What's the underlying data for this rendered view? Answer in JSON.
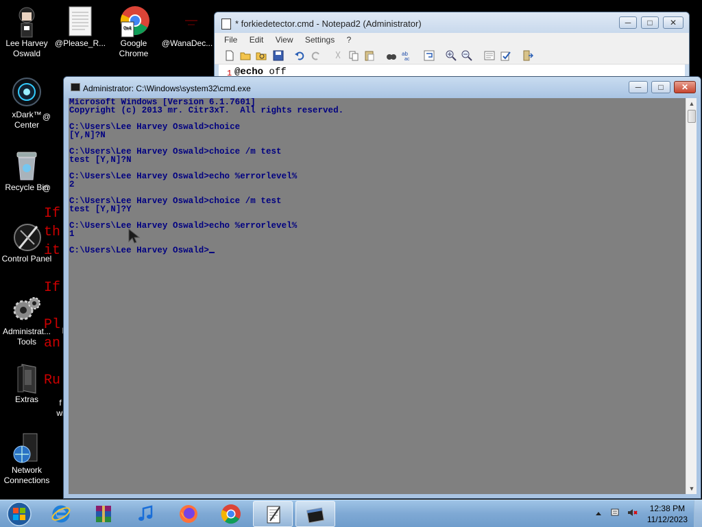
{
  "desktop": {
    "icons": [
      {
        "label": "Lee Harvey Oswald"
      },
      {
        "label": "@Please_R..."
      },
      {
        "label": "Google Chrome"
      },
      {
        "label": "@WanaDec..."
      },
      {
        "label": "xDark™ Center"
      },
      {
        "label": "Recycle Bin"
      },
      {
        "label": "Control Panel"
      },
      {
        "label": "Administrat... Tools"
      },
      {
        "label": "Extras"
      },
      {
        "label": "Network Connections"
      }
    ],
    "partial_labels": [
      "@",
      "@",
      "f",
      "wi",
      "I"
    ],
    "red_text": [
      "If",
      "th",
      "it",
      "If",
      "Pl",
      "an",
      "Ru"
    ]
  },
  "notepad": {
    "title": "* forkiedetector.cmd - Notepad2 (Administrator)",
    "menu": [
      "File",
      "Edit",
      "View",
      "Settings",
      "?"
    ],
    "line_number": "1",
    "code_keyword": "@echo",
    "code_rest": " off"
  },
  "cmd": {
    "title": "Administrator: C:\\Windows\\system32\\cmd.exe",
    "lines": [
      "Microsoft Windows [Version 6.1.7601]",
      "Copyright (c) 2013 mr. Citr3xT.  All rights reserved.",
      "",
      "C:\\Users\\Lee Harvey Oswald>choice",
      "[Y,N]?N",
      "",
      "C:\\Users\\Lee Harvey Oswald>choice /m test",
      "test [Y,N]?N",
      "",
      "C:\\Users\\Lee Harvey Oswald>echo %errorlevel%",
      "2",
      "",
      "C:\\Users\\Lee Harvey Oswald>choice /m test",
      "test [Y,N]?Y",
      "",
      "C:\\Users\\Lee Harvey Oswald>echo %errorlevel%",
      "1",
      ""
    ],
    "prompt": "C:\\Users\\Lee Harvey Oswald>",
    "console_bg": "#808080",
    "console_fg": "#000080"
  },
  "taskbar": {
    "items": [
      "start-orb-icon",
      "internet-explorer-icon",
      "winrar-icon",
      "itunes-icon",
      "firefox-icon",
      "chrome-icon",
      "notepad2-icon",
      "cmd-icon"
    ],
    "clock_time": "12:38 PM",
    "clock_date": "11/12/2023"
  }
}
